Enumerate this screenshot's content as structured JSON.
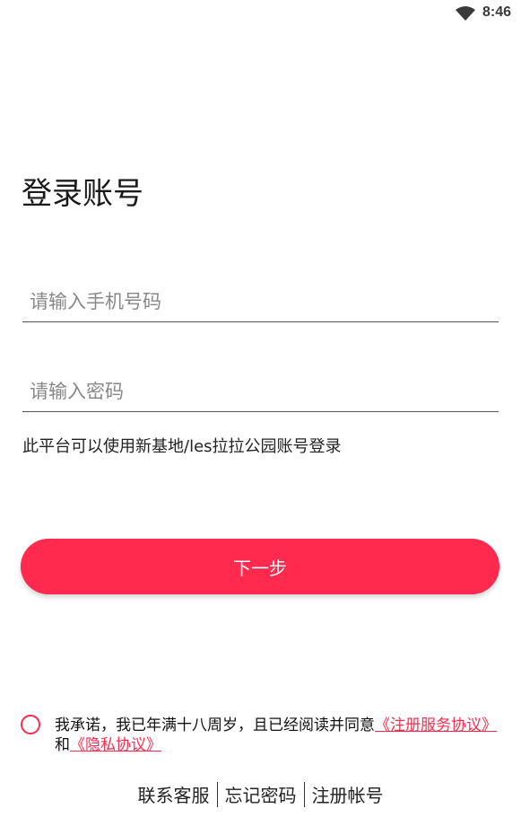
{
  "status_bar": {
    "time": "8:46",
    "wifi_icon": "wifi-icon"
  },
  "login": {
    "title": "登录账号",
    "phone_placeholder": "请输入手机号码",
    "password_placeholder": "请输入密码",
    "hint": "此平台可以使用新基地/les拉拉公园账号登录",
    "next_label": "下一步"
  },
  "agreement": {
    "text_before": "我承诺，我已年满十八周岁，且已经阅读并同意",
    "service_link": "《注册服务协议》",
    "connector": "和",
    "privacy_link": "《隐私协议》"
  },
  "footer": {
    "contact": "联系客服",
    "forgot_password": "忘记密码",
    "register": "注册帐号"
  },
  "colors": {
    "accent": "#ff2a4e"
  }
}
